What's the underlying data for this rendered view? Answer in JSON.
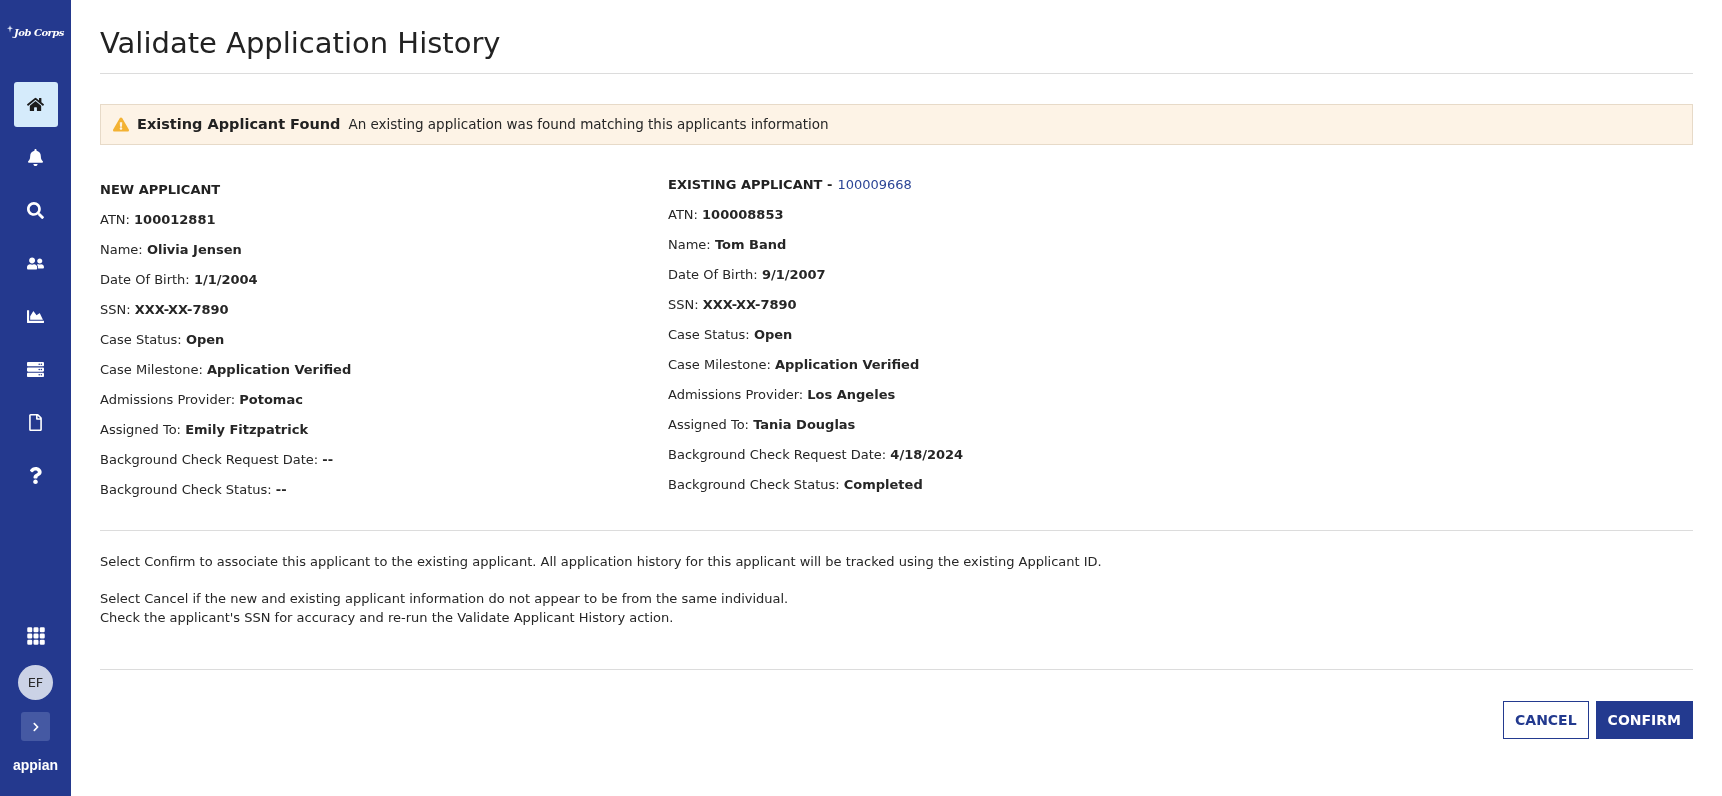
{
  "sidebar": {
    "logo": "Job Corps",
    "nav_items": [
      {
        "selected": true
      },
      {
        "selected": false
      },
      {
        "selected": false
      },
      {
        "selected": false
      },
      {
        "selected": false
      },
      {
        "selected": false
      },
      {
        "selected": false
      },
      {
        "selected": false
      }
    ],
    "avatar": "EF",
    "brand": "appian"
  },
  "page": {
    "title": "Validate Application History",
    "alert": {
      "title": "Existing Applicant Found",
      "message": "An existing application was found matching this applicants information"
    },
    "new_applicant": {
      "heading": "NEW APPLICANT",
      "fields": [
        "ATN: **100012881**",
        "Name: **Olivia Jensen**",
        "Date Of Birth: **1/1/2004**",
        "SSN: **XXX-XX-7890**",
        "Case Status: **Open**",
        "Case Milestone: **Application Verified**",
        "Admissions Provider: **Potomac**",
        "Assigned To: **Emily Fitzpatrick**",
        "Background Check Request Date: **--**",
        "Background Check Status: **--**"
      ]
    },
    "existing_applicant": {
      "heading": "EXISTING APPLICANT -",
      "link": "100009668",
      "fields": [
        "ATN: **100008853**",
        "Name: **Tom Band**",
        "Date Of Birth: **9/1/2007**",
        "SSN: **XXX-XX-7890**",
        "Case Status: **Open**",
        "Case Milestone: **Application Verified**",
        "Admissions Provider: **Los Angeles**",
        "Assigned To: **Tania Douglas**",
        "Background Check Request Date: **4/18/2024**",
        "Background Check Status: **Completed**"
      ]
    },
    "instructions": [
      [
        "Select Confirm to associate this applicant to the existing applicant. All application history for this applicant will be tracked using the existing Applicant ID."
      ],
      [
        "Select Cancel if the new and existing applicant information do not appear to be from the same individual.",
        "Check the applicant's SSN for accuracy and re-run the Validate Applicant History action."
      ]
    ],
    "buttons": [
      {
        "label": "CANCEL",
        "kind": "secondary"
      },
      {
        "label": "CONFIRM",
        "kind": "primary"
      }
    ]
  }
}
